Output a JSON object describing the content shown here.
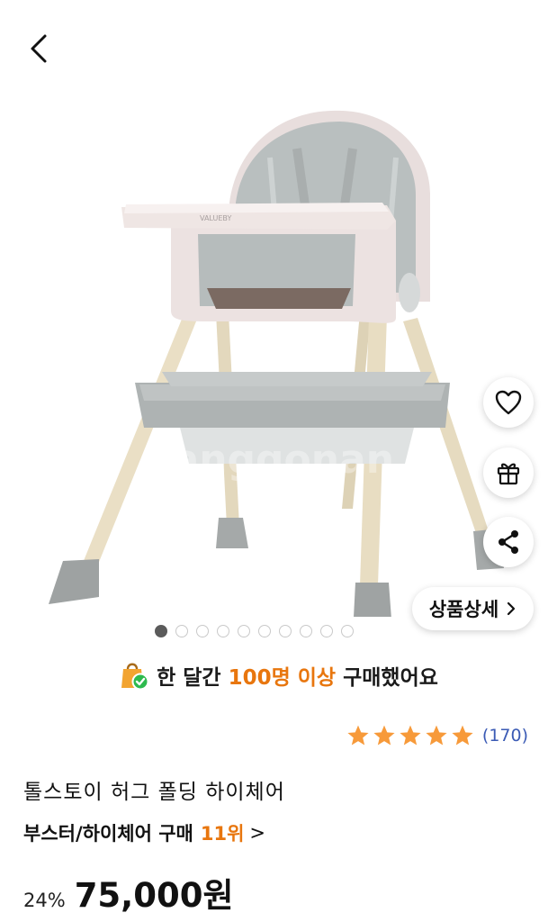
{
  "header": {
    "back_icon": "chevron-left-icon"
  },
  "image": {
    "watermark": "danggonan",
    "tray_brand": "VALUEBY",
    "total_slides": 10,
    "active_slide": 1
  },
  "side_actions": [
    {
      "icon": "heart-icon"
    },
    {
      "icon": "gift-icon"
    },
    {
      "icon": "share-icon"
    }
  ],
  "detail_button": {
    "label": "상품상세",
    "icon": "chevron-right-icon"
  },
  "banner": {
    "prefix": "한 달간 ",
    "highlight": "100명 이상",
    "suffix": " 구매했어요",
    "icon": "shopping-bag-check-icon"
  },
  "rating": {
    "stars": 5,
    "count": "(170)",
    "star_color": "#f79a3a"
  },
  "product": {
    "title": "톨스토이 허그 폴딩 하이체어",
    "rank_prefix": "부스터/하이체어 구매",
    "rank_value": "11위",
    "rank_suffix": ">",
    "discount": "24%",
    "price": "75,000원"
  },
  "colors": {
    "accent": "#e8760e",
    "link": "#3b5bb5"
  }
}
